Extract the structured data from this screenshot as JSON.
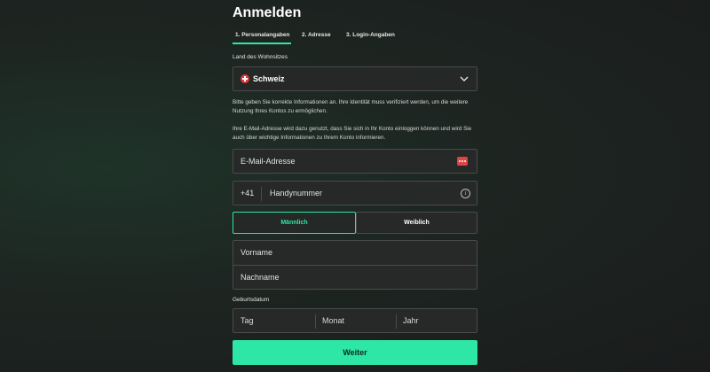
{
  "header": {
    "title": "Anmelden"
  },
  "steps": [
    {
      "label": "1. Personalangaben"
    },
    {
      "label": "2. Adresse"
    },
    {
      "label": "3. Login-Angaben"
    }
  ],
  "country": {
    "label": "Land des Wohnsitzes",
    "value": "Schweiz",
    "flag_icon": "swiss-flag-icon"
  },
  "info": {
    "paragraph1": "Bitte geben Sie korrekte Informationen an. Ihre Identität muss verifiziert werden, um die weitere Nutzung Ihres Kontos zu ermöglichen.",
    "paragraph2": "Ihre E-Mail-Adresse wird dazu genutzt, dass Sie sich in Ihr Konto einloggen können und wird Sie auch über wichtige Informationen zu Ihrem Konto informieren."
  },
  "email": {
    "placeholder": "E-Mail-Adresse"
  },
  "phone": {
    "prefix": "+41",
    "placeholder": "Handynummer"
  },
  "gender": {
    "male": "Männlich",
    "female": "Weiblich",
    "selected": "male"
  },
  "name": {
    "first_placeholder": "Vorname",
    "last_placeholder": "Nachname"
  },
  "birthdate": {
    "label": "Geburtsdatum",
    "day_placeholder": "Tag",
    "month_placeholder": "Monat",
    "year_placeholder": "Jahr"
  },
  "submit": {
    "label": "Weiter"
  },
  "colors": {
    "accent": "#2ee6a6",
    "background": "#1d2521",
    "field_border": "#4a4a4a"
  }
}
